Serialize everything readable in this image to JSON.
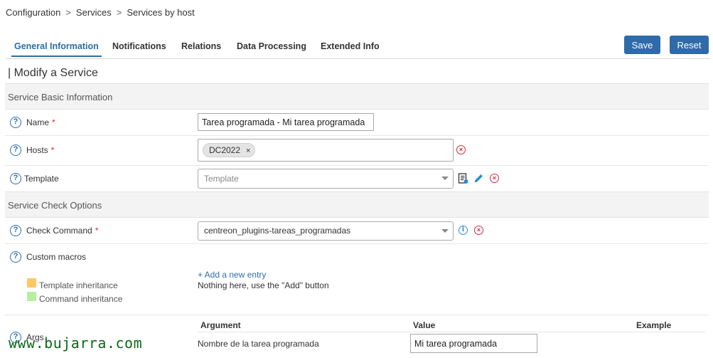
{
  "breadcrumb": {
    "items": [
      "Configuration",
      "Services",
      "Services by host"
    ],
    "separator": ">"
  },
  "tabs": [
    {
      "label": "General Information",
      "active": true
    },
    {
      "label": "Notifications",
      "active": false
    },
    {
      "label": "Relations",
      "active": false
    },
    {
      "label": "Data Processing",
      "active": false
    },
    {
      "label": "Extended Info",
      "active": false
    }
  ],
  "toolbar": {
    "save_label": "Save",
    "reset_label": "Reset",
    "accent": "#2e6ba8"
  },
  "page_title": "| Modify a Service",
  "sections": {
    "basic": "Service Basic Information",
    "check": "Service Check Options"
  },
  "fields": {
    "name": {
      "label": "Name",
      "required_mark": "*",
      "value": "Tarea programada - Mi tarea programada"
    },
    "hosts": {
      "label": "Hosts",
      "required_mark": "*",
      "chip": "DC2022",
      "chip_remove": "×"
    },
    "template": {
      "label": "Template",
      "placeholder": "Template"
    },
    "check_command": {
      "label": "Check Command",
      "required_mark": "*",
      "value": "centreon_plugins-tareas_programadas"
    },
    "custom_macros": {
      "label": "Custom macros",
      "add_entry": "+ Add a new entry",
      "empty_text": "Nothing here, use the \"Add\" button",
      "legend": [
        {
          "label": "Template inheritance",
          "color": "#ffc864"
        },
        {
          "label": "Command inheritance",
          "color": "#b4f0a0"
        }
      ]
    },
    "args": {
      "label": "Args",
      "headers": [
        "Argument",
        "Value",
        "Example"
      ],
      "rows": [
        {
          "argument": "Nombre de la tarea programada",
          "value": "Mi tarea programada",
          "example": ""
        }
      ]
    }
  },
  "icons": {
    "help": "question-circle-icon",
    "delete": "remove-circle-icon",
    "info": "info-circle-icon",
    "view": "view-template-icon",
    "edit": "pencil-icon"
  },
  "watermark": "www.bujarra.com"
}
